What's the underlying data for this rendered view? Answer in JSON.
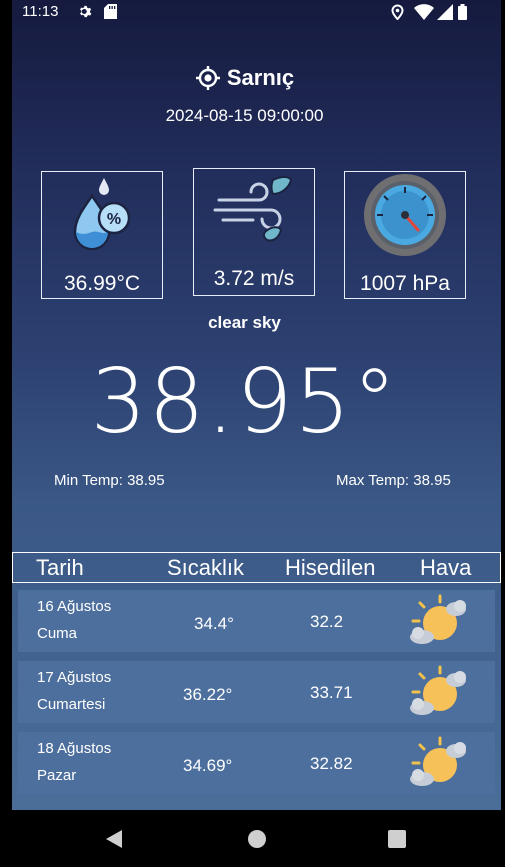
{
  "status_bar": {
    "time": "11:13"
  },
  "header": {
    "location": "Sarnıç",
    "datetime": "2024-08-15 09:00:00"
  },
  "metrics": {
    "humidity": "36.99°C",
    "wind": "3.72 m/s",
    "pressure": "1007 hPa"
  },
  "current": {
    "description": "clear sky",
    "temperature": "38.95°",
    "min_temp": "Min Temp: 38.95",
    "max_temp": "Max Temp: 38.95"
  },
  "table": {
    "headers": [
      "Tarih",
      "Sıcaklık",
      "Hisedilen",
      "Hava"
    ],
    "rows": [
      {
        "date": "16 Ağustos",
        "day": "Cuma",
        "temp": "34.4°",
        "feels": "32.2",
        "icon": "partly-cloudy-icon"
      },
      {
        "date": "17 Ağustos",
        "day": "Cumartesi",
        "temp": "36.22°",
        "feels": "33.71",
        "icon": "partly-cloudy-icon"
      },
      {
        "date": "18 Ağustos",
        "day": "Pazar",
        "temp": "34.69°",
        "feels": "32.82",
        "icon": "partly-cloudy-icon"
      }
    ]
  }
}
